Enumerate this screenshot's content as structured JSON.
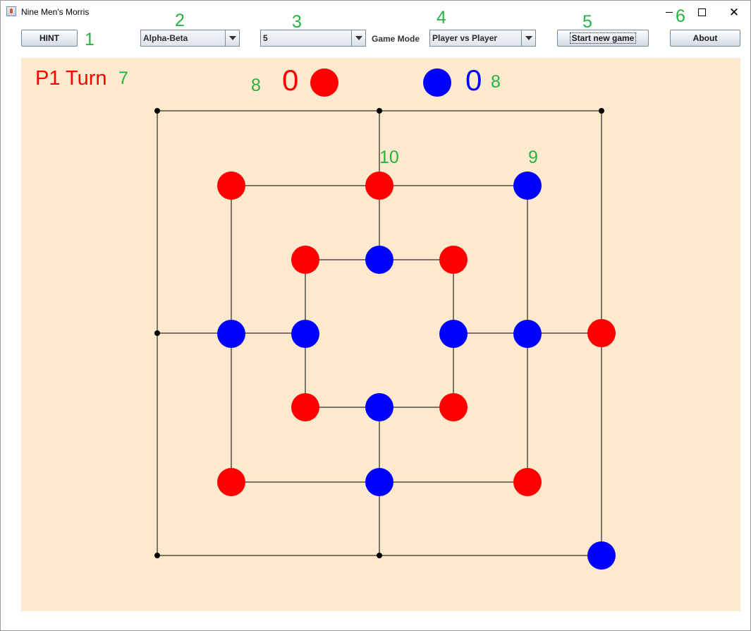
{
  "window": {
    "title": "Nine Men's Morris",
    "icon": "java-icon",
    "controls": [
      "minimize-icon",
      "maximize-icon",
      "close-icon"
    ],
    "close_glyph": "✕"
  },
  "toolbar": {
    "hint_label": "HINT",
    "algorithm_value": "Alpha-Beta",
    "depth_value": "5",
    "game_mode_label": "Game Mode",
    "game_mode_value": "Player vs Player",
    "start_label": "Start new game",
    "about_label": "About"
  },
  "status": {
    "turn_text": "P1 Turn",
    "p1_score": "0",
    "p2_score": "0"
  },
  "annotations": {
    "hint": "1",
    "algorithm": "2",
    "depth": "3",
    "game_mode": "4",
    "start": "5",
    "about": "6",
    "turn": "7",
    "score_left": "8",
    "score_right": "8",
    "piece": "9",
    "empty_point": "10"
  },
  "colors": {
    "player1": "#ff0000",
    "player2": "#0000ff",
    "board_bg": "#fde9cd",
    "annotation": "#27b33f"
  },
  "board": {
    "points": [
      {
        "ring": "outer",
        "pos": "top-left",
        "piece": "empty"
      },
      {
        "ring": "outer",
        "pos": "top-middle",
        "piece": "empty"
      },
      {
        "ring": "outer",
        "pos": "top-right",
        "piece": "empty"
      },
      {
        "ring": "outer",
        "pos": "middle-left",
        "piece": "empty"
      },
      {
        "ring": "outer",
        "pos": "middle-right",
        "piece": "red"
      },
      {
        "ring": "outer",
        "pos": "bottom-left",
        "piece": "empty"
      },
      {
        "ring": "outer",
        "pos": "bottom-middle",
        "piece": "empty"
      },
      {
        "ring": "outer",
        "pos": "bottom-right",
        "piece": "blue"
      },
      {
        "ring": "middle",
        "pos": "top-left",
        "piece": "red"
      },
      {
        "ring": "middle",
        "pos": "top-middle",
        "piece": "red"
      },
      {
        "ring": "middle",
        "pos": "top-right",
        "piece": "blue"
      },
      {
        "ring": "middle",
        "pos": "middle-left",
        "piece": "blue"
      },
      {
        "ring": "middle",
        "pos": "middle-right",
        "piece": "blue"
      },
      {
        "ring": "middle",
        "pos": "bottom-left",
        "piece": "red"
      },
      {
        "ring": "middle",
        "pos": "bottom-middle",
        "piece": "blue"
      },
      {
        "ring": "middle",
        "pos": "bottom-right",
        "piece": "red"
      },
      {
        "ring": "inner",
        "pos": "top-left",
        "piece": "red"
      },
      {
        "ring": "inner",
        "pos": "top-middle",
        "piece": "blue"
      },
      {
        "ring": "inner",
        "pos": "top-right",
        "piece": "red"
      },
      {
        "ring": "inner",
        "pos": "middle-left",
        "piece": "blue"
      },
      {
        "ring": "inner",
        "pos": "middle-right",
        "piece": "blue"
      },
      {
        "ring": "inner",
        "pos": "bottom-left",
        "piece": "red"
      },
      {
        "ring": "inner",
        "pos": "bottom-middle",
        "piece": "blue"
      },
      {
        "ring": "inner",
        "pos": "bottom-right",
        "piece": "red"
      }
    ]
  }
}
